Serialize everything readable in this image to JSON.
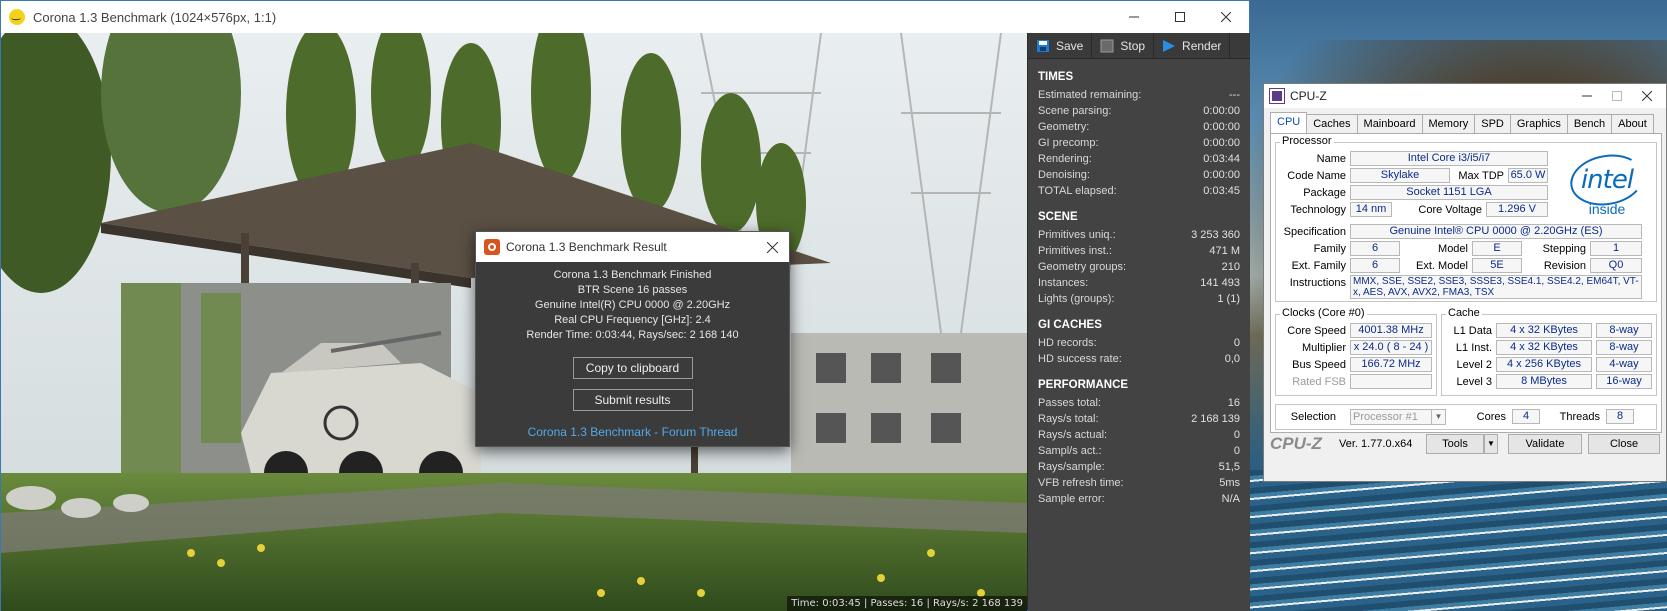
{
  "corona_window": {
    "title": "Corona 1.3 Benchmark (1024×576px, 1:1)",
    "status_strip": "Time: 0:03:45 | Passes: 16 | Rays/s: 2 168 139"
  },
  "toolbar": {
    "save_label": "Save",
    "stop_label": "Stop",
    "render_label": "Render"
  },
  "times": {
    "title": "TIMES",
    "rows": [
      {
        "label": "Estimated remaining:",
        "value": "---"
      },
      {
        "label": "Scene parsing:",
        "value": "0:00:00"
      },
      {
        "label": "Geometry:",
        "value": "0:00:00"
      },
      {
        "label": "GI precomp:",
        "value": "0:00:00"
      },
      {
        "label": "Rendering:",
        "value": "0:03:44"
      },
      {
        "label": "Denoising:",
        "value": "0:00:00"
      },
      {
        "label": "TOTAL elapsed:",
        "value": "0:03:45"
      }
    ]
  },
  "scene": {
    "title": "SCENE",
    "rows": [
      {
        "label": "Primitives uniq.:",
        "value": "3 253 360"
      },
      {
        "label": "Primitives inst.:",
        "value": "471 M"
      },
      {
        "label": "Geometry groups:",
        "value": "210"
      },
      {
        "label": "Instances:",
        "value": "141 493"
      },
      {
        "label": "Lights (groups):",
        "value": "1 (1)"
      }
    ]
  },
  "gi_caches": {
    "title": "GI CACHES",
    "rows": [
      {
        "label": "HD records:",
        "value": "0"
      },
      {
        "label": "HD success rate:",
        "value": "0,0"
      }
    ]
  },
  "performance": {
    "title": "PERFORMANCE",
    "rows": [
      {
        "label": "Passes total:",
        "value": "16"
      },
      {
        "label": "Rays/s total:",
        "value": "2 168 139"
      },
      {
        "label": "Rays/s actual:",
        "value": "0"
      },
      {
        "label": "Sampl/s act.:",
        "value": "0"
      },
      {
        "label": "Rays/sample:",
        "value": "51,5"
      },
      {
        "label": "VFB refresh time:",
        "value": "5ms"
      },
      {
        "label": "Sample error:",
        "value": "N/A"
      }
    ]
  },
  "result_dialog": {
    "title": "Corona 1.3 Benchmark Result",
    "lines": [
      "Corona 1.3 Benchmark Finished",
      "BTR Scene 16 passes",
      "Genuine Intel(R) CPU 0000 @ 2.20GHz",
      "Real CPU Frequency [GHz]: 2.4",
      "Render Time: 0:03:44, Rays/sec: 2 168 140"
    ],
    "copy_button": "Copy to clipboard",
    "submit_button": "Submit results",
    "forum_link": "Corona 1.3 Benchmark - Forum Thread"
  },
  "cpuz": {
    "title": "CPU-Z",
    "tabs": [
      "CPU",
      "Caches",
      "Mainboard",
      "Memory",
      "SPD",
      "Graphics",
      "Bench",
      "About"
    ],
    "processor": {
      "group_label": "Processor",
      "name_label": "Name",
      "name": "Intel Core i3/i5/i7",
      "codename_label": "Code Name",
      "codename": "Skylake",
      "maxtdp_label": "Max TDP",
      "maxtdp": "65.0 W",
      "package_label": "Package",
      "package": "Socket 1151 LGA",
      "technology_label": "Technology",
      "technology": "14 nm",
      "corevoltage_label": "Core Voltage",
      "corevoltage": "1.296 V",
      "spec_label": "Specification",
      "spec": "Genuine Intel® CPU 0000 @ 2.20GHz (ES)",
      "family_label": "Family",
      "family": "6",
      "model_label": "Model",
      "model": "E",
      "stepping_label": "Stepping",
      "stepping": "1",
      "extfamily_label": "Ext. Family",
      "extfamily": "6",
      "extmodel_label": "Ext. Model",
      "extmodel": "5E",
      "revision_label": "Revision",
      "revision": "Q0",
      "instructions_label": "Instructions",
      "instructions": "MMX, SSE, SSE2, SSE3, SSSE3, SSE4.1, SSE4.2, EM64T, VT-x, AES, AVX, AVX2, FMA3, TSX"
    },
    "logo": {
      "word": "intel",
      "inside": "inside"
    },
    "clocks": {
      "group_label": "Clocks (Core #0)",
      "corespeed_label": "Core Speed",
      "corespeed": "4001.38 MHz",
      "multiplier_label": "Multiplier",
      "multiplier": "x 24.0 ( 8 - 24 )",
      "busspeed_label": "Bus Speed",
      "busspeed": "166.72 MHz",
      "ratedfsb_label": "Rated FSB",
      "ratedfsb": ""
    },
    "cache": {
      "group_label": "Cache",
      "l1data_label": "L1 Data",
      "l1data": "4 x 32 KBytes",
      "l1data_way": "8-way",
      "l1inst_label": "L1 Inst.",
      "l1inst": "4 x 32 KBytes",
      "l1inst_way": "8-way",
      "level2_label": "Level 2",
      "level2": "4 x 256 KBytes",
      "level2_way": "4-way",
      "level3_label": "Level 3",
      "level3": "8 MBytes",
      "level3_way": "16-way"
    },
    "selection": {
      "label": "Selection",
      "value": "Processor #1",
      "cores_label": "Cores",
      "cores": "4",
      "threads_label": "Threads",
      "threads": "8"
    },
    "footer": {
      "brand": "CPU-Z",
      "version": "Ver. 1.77.0.x64",
      "tools": "Tools",
      "validate": "Validate",
      "close": "Close"
    }
  }
}
